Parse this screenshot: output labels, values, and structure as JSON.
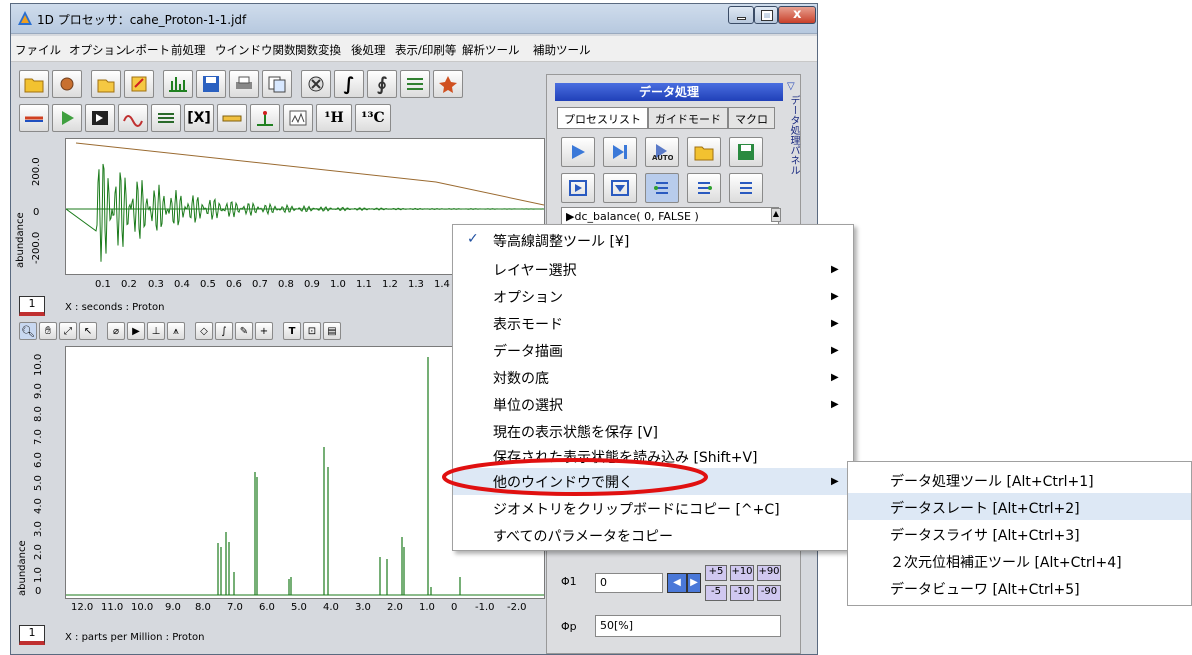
{
  "window": {
    "title": "1D プロセッサ：cahe_Proton-1-1.jdf"
  },
  "menu": [
    "ファイル",
    "オプション",
    "レポート",
    "前処理",
    "ウインドウ関数",
    "関数変換",
    "後処理",
    "表示/印刷等",
    "解析ツール",
    "補助ツール"
  ],
  "toolbar": {
    "h1": "¹H",
    "c13": "¹³C"
  },
  "top_plot": {
    "ylabel": "abundance",
    "yticks": [
      "200.0",
      "0",
      "-200.0"
    ],
    "xticks": [
      "0.1",
      "0.2",
      "0.3",
      "0.4",
      "0.5",
      "0.6",
      "0.7",
      "0.8",
      "0.9",
      "1.0",
      "1.1",
      "1.2",
      "1.3",
      "1.4"
    ],
    "xlabel": "X : seconds : Proton",
    "channel": "1"
  },
  "bottom_plot": {
    "ylabel": "abundance",
    "yticks": [
      "10.0",
      "9.0",
      "8.0",
      "7.0",
      "6.0",
      "5.0",
      "4.0",
      "3.0",
      "2.0",
      "1.0",
      "0"
    ],
    "xticks": [
      "12.0",
      "11.0",
      "10.0",
      "9.0",
      "8.0",
      "7.0",
      "6.0",
      "5.0",
      "4.0",
      "3.0",
      "2.0",
      "1.0",
      "0",
      "-1.0",
      "-2.0"
    ],
    "xlabel": "X : parts per Million : Proton",
    "channel": "1"
  },
  "panel": {
    "header": "データ処理",
    "side_label": "データ処理パネル",
    "tabs": [
      "プロセスリスト",
      "ガイドモード",
      "マクロ"
    ],
    "process_item": "▶dc_balance( 0, FALSE )",
    "phi1_label": "Φ1",
    "phi1_value": "0",
    "phip_label": "Φp",
    "phip_value": "50[%]",
    "steps_pos": [
      "+5",
      "+10",
      "+90"
    ],
    "steps_neg": [
      "-5",
      "-10",
      "-90"
    ]
  },
  "context_menu": {
    "items": [
      {
        "label": "等高線調整ツール [¥]",
        "checked": true,
        "submenu": false
      },
      {
        "label": "レイヤー選択",
        "submenu": true
      },
      {
        "label": "オプション",
        "submenu": true
      },
      {
        "label": "表示モード",
        "submenu": true
      },
      {
        "label": "データ描画",
        "submenu": true
      },
      {
        "label": "対数の底",
        "submenu": true
      },
      {
        "label": "単位の選択",
        "submenu": true
      },
      {
        "label": "現在の表示状態を保存 [V]",
        "submenu": false
      },
      {
        "label": "保存された表示状態を読み込み [Shift+V]",
        "submenu": false
      },
      {
        "label": "他のウインドウで開く",
        "submenu": true,
        "highlighted": true
      },
      {
        "label": "ジオメトリをクリップボードにコピー [^+C]",
        "submenu": false
      },
      {
        "label": "すべてのパラメータをコピー",
        "submenu": false
      }
    ]
  },
  "submenu": {
    "items": [
      "データ処理ツール [Alt+Ctrl+1]",
      "データスレート [Alt+Ctrl+2]",
      "データスライサ [Alt+Ctrl+3]",
      "２次元位相補正ツール [Alt+Ctrl+4]",
      "データビューワ [Alt+Ctrl+5]"
    ],
    "highlighted_index": 1
  },
  "colors": {
    "spectrum": "#1a7a1a",
    "highlight_ring": "#e01010",
    "menu_highlight": "#dde8f5",
    "title_bar": "#bccde2",
    "panel_header": "#3050c8"
  }
}
